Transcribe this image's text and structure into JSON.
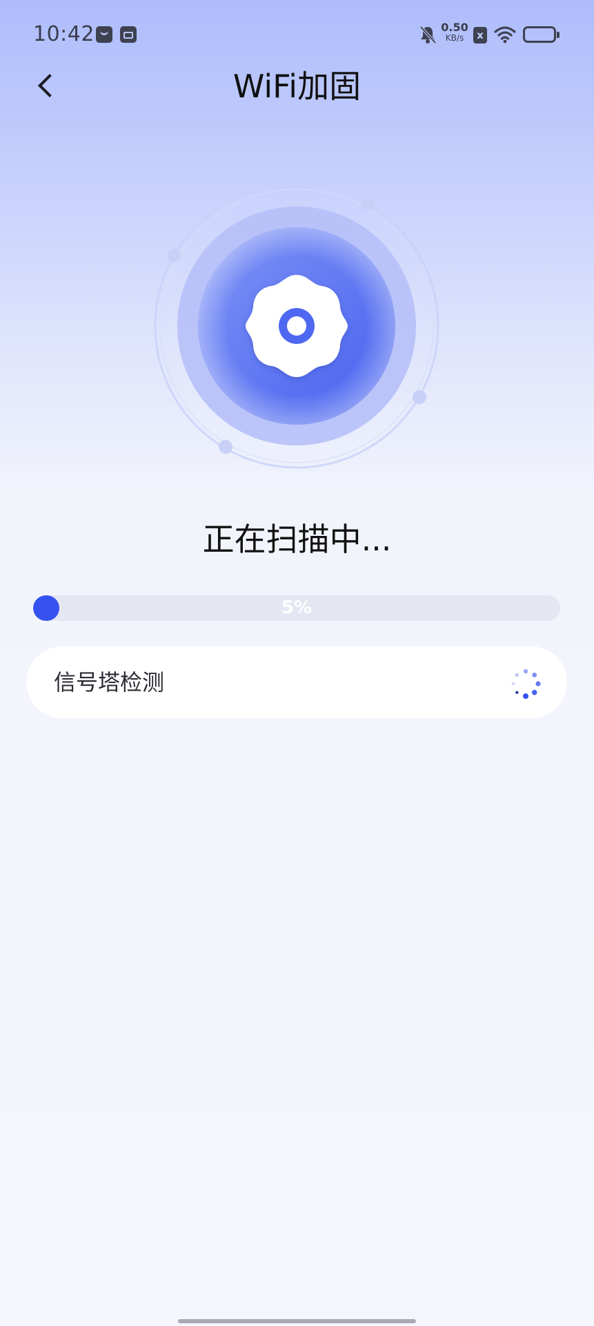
{
  "status_bar": {
    "time": "10:42",
    "net_speed_value": "0.50",
    "net_speed_unit": "KB/s",
    "sim_label": "x",
    "icons": [
      "app-notification-icon",
      "app-notification-icon",
      "mute-bell-icon",
      "sim-icon",
      "wifi-icon",
      "battery-icon"
    ]
  },
  "header": {
    "back_icon": "chevron-left-icon",
    "title": "WiFi加固"
  },
  "scanner": {
    "center_icon": "gear-icon",
    "colors": {
      "outer_ring": "#c7cff9",
      "middle_disc": "#b7c2f8",
      "inner_disc_start": "#7b8ff5",
      "inner_disc_end": "#4a62f0",
      "gear": "#ffffff"
    }
  },
  "scan": {
    "status_text": "正在扫描中...",
    "progress_percent": 5,
    "progress_label": "5%",
    "accent_color": "#3552f0"
  },
  "checks": [
    {
      "label": "信号塔检测",
      "state_icon": "loading-spinner-icon"
    }
  ]
}
